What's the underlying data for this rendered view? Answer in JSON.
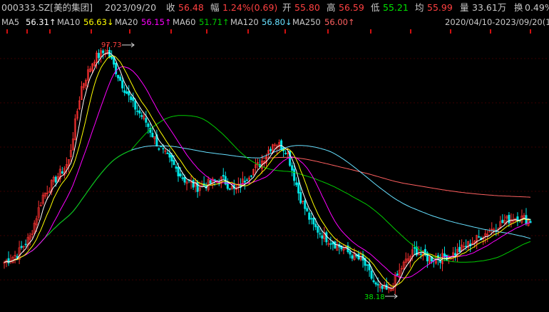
{
  "header": {
    "stock": "000333.SZ[美的集团]",
    "date": "2023/09/20",
    "close_label": "收",
    "close": "56.48",
    "change_label": "幅",
    "change": "1.24%(0.69)",
    "open_label": "开",
    "open": "55.80",
    "high_label": "高",
    "high": "56.59",
    "low_label": "低",
    "low": "55.21",
    "avg_label": "均",
    "avg": "55.99",
    "volume_label": "量",
    "volume": "33.61万",
    "turnover_label": "换",
    "turnover": "0.49%"
  },
  "ma_bar": {
    "ma5_label": "MA5",
    "ma5": "56.31↑",
    "ma10_label": "MA10",
    "ma10": "56.63↓",
    "ma20_label": "MA20",
    "ma20": "56.15↑",
    "ma60_label": "MA60",
    "ma60": "51.71↑",
    "ma120_label": "MA120",
    "ma120": "56.80↓",
    "ma250_label": "MA250",
    "ma250": "56.00↑",
    "range": "2020/04/10-2023/09/20(1"
  },
  "annotations": {
    "high": "97.73",
    "low": "38.18"
  },
  "colors": {
    "up": "#ff3232",
    "down": "#00e5e5",
    "ma5": "#ffffff",
    "ma10": "#ffff00",
    "ma20": "#ff00ff",
    "ma60": "#00cc00",
    "ma120": "#66e0ff",
    "ma250": "#ff6060",
    "label_green": "#00e600",
    "label_red": "#ff4040"
  },
  "chart_data": {
    "type": "candlestick",
    "x_range": [
      "2020/04/10",
      "2023/09/20"
    ],
    "y_range_visible": [
      38.18,
      97.73
    ],
    "ma_values_last": {
      "MA5": 56.31,
      "MA10": 56.63,
      "MA20": 56.15,
      "MA60": 51.71,
      "MA120": 56.8,
      "MA250": 56.0
    },
    "price_trend": [
      46,
      48,
      52,
      62,
      66,
      70,
      88,
      95,
      97,
      90,
      84,
      80,
      74,
      70,
      66,
      64,
      65,
      66,
      63,
      67,
      70,
      75,
      73,
      62,
      55,
      52,
      50,
      48,
      46,
      40,
      39,
      45,
      49,
      47,
      47,
      48,
      50,
      52,
      54,
      56,
      57,
      56
    ]
  }
}
